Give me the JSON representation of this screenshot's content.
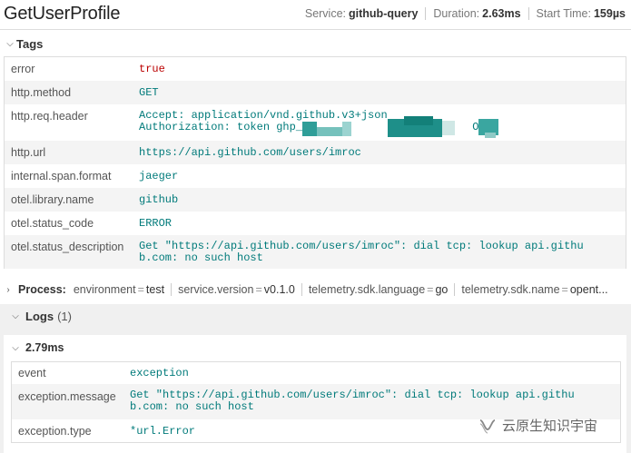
{
  "header": {
    "title": "GetUserProfile",
    "service_label": "Service:",
    "service_value": "github-query",
    "duration_label": "Duration:",
    "duration_value": "2.63ms",
    "start_label": "Start Time:",
    "start_value": "159µs"
  },
  "tags": {
    "label": "Tags",
    "rows": [
      {
        "key": "error",
        "value": "true"
      },
      {
        "key": "http.method",
        "value": "GET"
      },
      {
        "key": "http.req.header",
        "value": "Accept: application/vnd.github.v3+json\nAuthorization: token ghp_                          Okjd"
      },
      {
        "key": "http.url",
        "value": "https://api.github.com/users/imroc"
      },
      {
        "key": "internal.span.format",
        "value": "jaeger"
      },
      {
        "key": "otel.library.name",
        "value": "github"
      },
      {
        "key": "otel.status_code",
        "value": "ERROR"
      },
      {
        "key": "otel.status_description",
        "value": "Get \"https://api.github.com/users/imroc\": dial tcp: lookup api.githu\nb.com: no such host"
      }
    ]
  },
  "process": {
    "label": "Process:",
    "items": [
      {
        "key": "environment",
        "value": "test"
      },
      {
        "key": "service.version",
        "value": "v0.1.0"
      },
      {
        "key": "telemetry.sdk.language",
        "value": "go"
      },
      {
        "key": "telemetry.sdk.name",
        "value": "opent..."
      }
    ]
  },
  "logs": {
    "label": "Logs",
    "count": "(1)",
    "entry": {
      "time": "2.79ms",
      "rows": [
        {
          "key": "event",
          "value": "exception"
        },
        {
          "key": "exception.message",
          "value": "Get \"https://api.github.com/users/imroc\": dial tcp: lookup api.githu\nb.com: no such host"
        },
        {
          "key": "exception.type",
          "value": "*url.Error"
        }
      ]
    }
  },
  "watermark": {
    "text": "云原生知识宇宙",
    "icon": "wechat-channel-icon"
  },
  "colors": {
    "tag_value": "#007a7a",
    "error_value": "#bb0000",
    "redaction": "#3aa6a0"
  }
}
